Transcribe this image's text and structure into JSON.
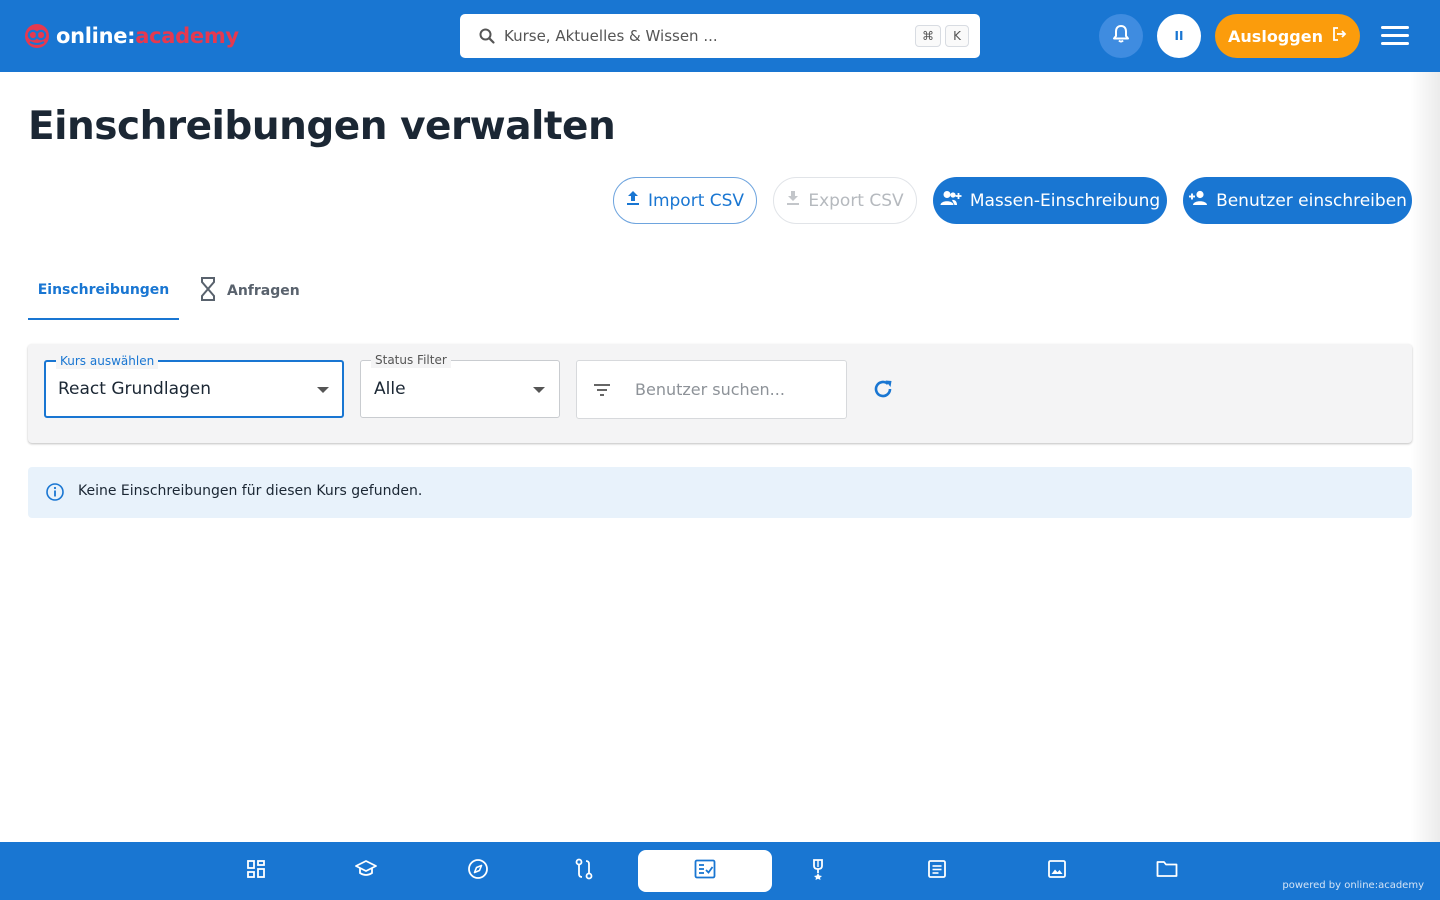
{
  "colors": {
    "primary": "#1976d2",
    "logout": "#fb9c0c",
    "brand_red": "#e53950",
    "info_bg": "#e8f2fb"
  },
  "header": {
    "logo": {
      "part1": "online:",
      "part2": "academy"
    },
    "search": {
      "placeholder": "Kurse, Aktuelles & Wissen ...",
      "shortcut_key1": "⌘",
      "shortcut_key2": "K"
    },
    "notifications_icon": "bell-icon",
    "avatar_initials": "II",
    "logout_label": "Ausloggen",
    "menu_icon": "hamburger-icon"
  },
  "page": {
    "title": "Einschreibungen verwalten",
    "actions": {
      "import_label": "Import CSV",
      "export_label": "Export CSV",
      "bulk_label": "Massen-Einschreibung",
      "enroll_label": "Benutzer einschreiben"
    },
    "tabs": [
      {
        "label": "Einschreibungen",
        "active": true
      },
      {
        "label": "Anfragen",
        "active": false,
        "icon": "hourglass-icon"
      }
    ]
  },
  "filters": {
    "course": {
      "label": "Kurs auswählen",
      "value": "React Grundlagen"
    },
    "status": {
      "label": "Status Filter",
      "value": "Alle"
    },
    "user_search": {
      "placeholder": "Benutzer suchen..."
    },
    "refresh_icon": "refresh-icon"
  },
  "alert": {
    "icon": "info-icon",
    "text": "Keine Einschreibungen für diesen Kurs gefunden."
  },
  "bottom_nav": {
    "items": [
      {
        "icon": "dashboard-icon",
        "active": false
      },
      {
        "icon": "graduation-cap-icon",
        "active": false
      },
      {
        "icon": "compass-icon",
        "active": false
      },
      {
        "icon": "route-icon",
        "active": false
      },
      {
        "icon": "enrollment-list-icon",
        "active": true
      },
      {
        "icon": "trophy-icon",
        "active": false
      },
      {
        "icon": "article-icon",
        "active": false
      },
      {
        "icon": "image-icon",
        "active": false
      },
      {
        "icon": "folder-icon",
        "active": false
      }
    ],
    "powered_by": "powered by online:academy"
  }
}
